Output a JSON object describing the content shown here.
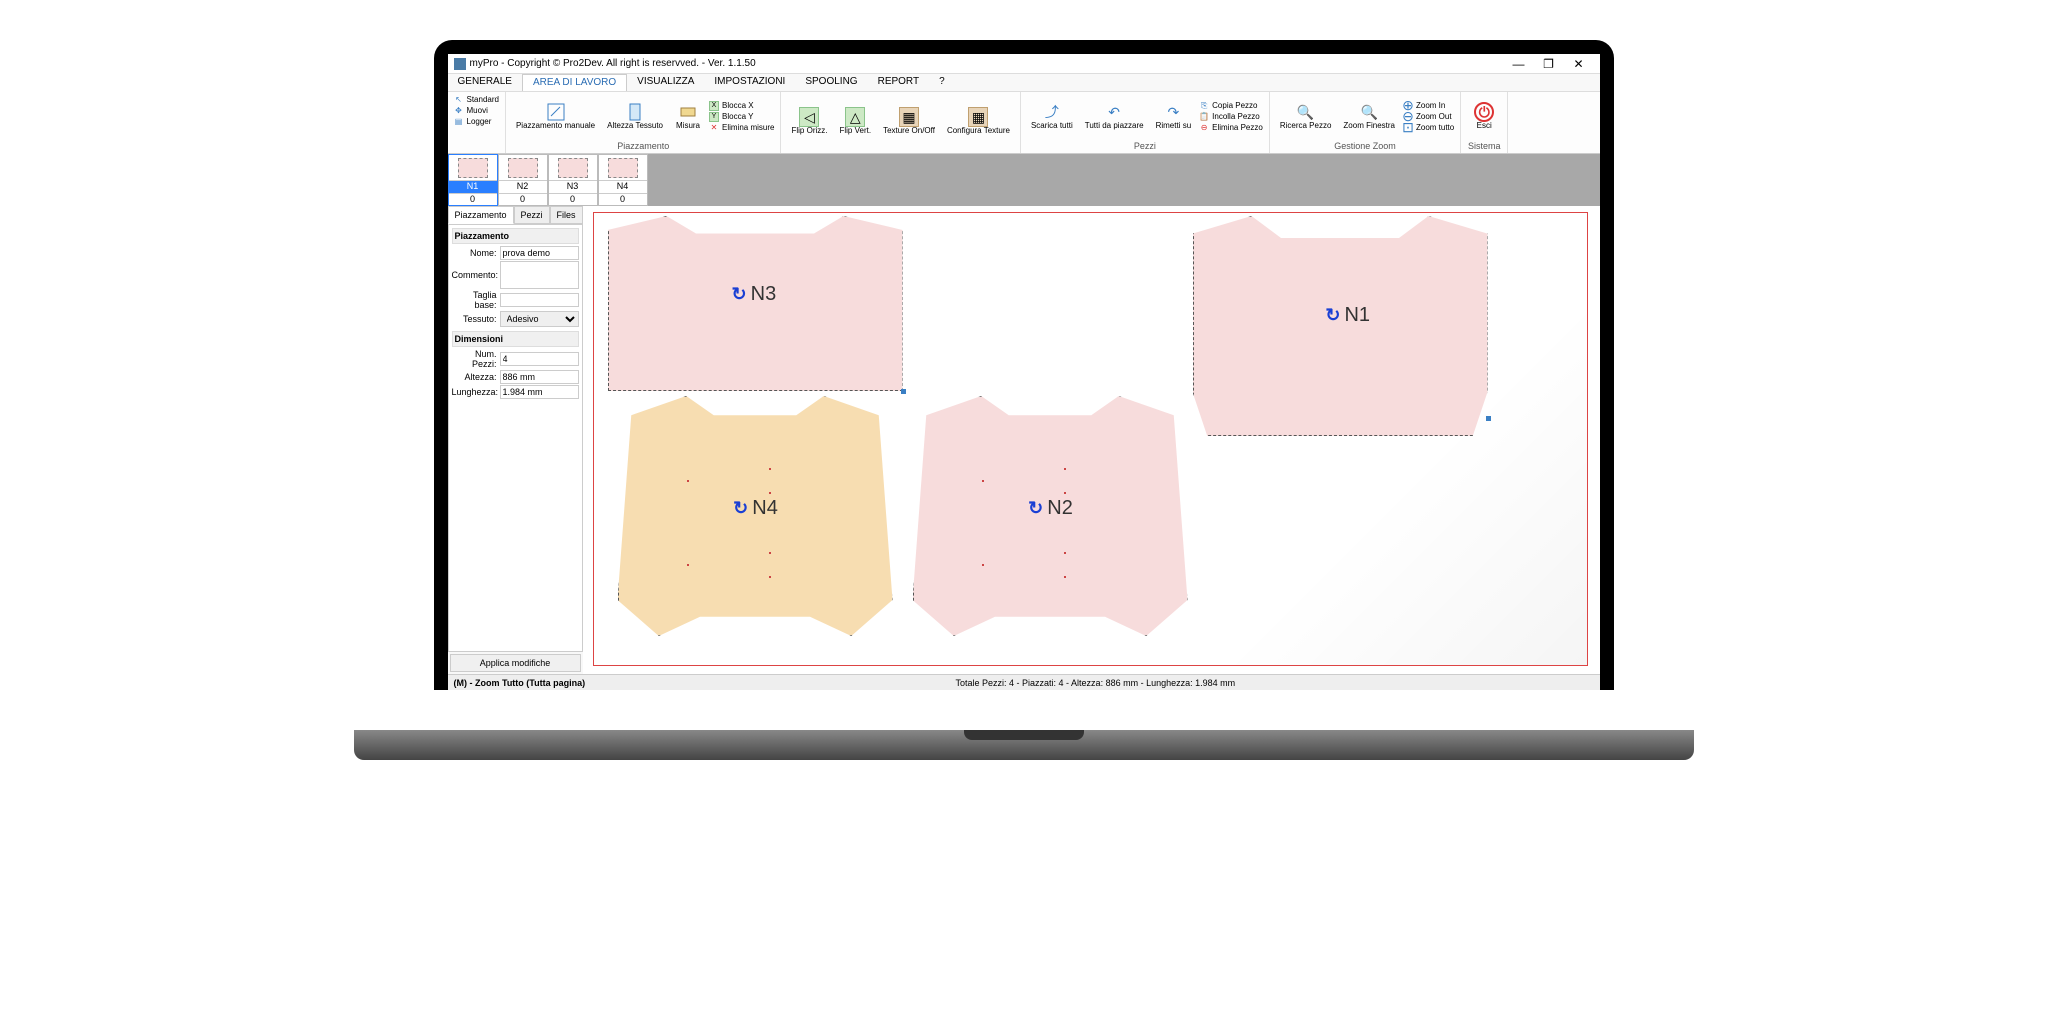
{
  "title": "myPro - Copyright © Pro2Dev. All right is reservved. - Ver. 1.1.50",
  "menu": [
    "GENERALE",
    "AREA DI LAVORO",
    "VISUALIZZA",
    "IMPOSTAZIONI",
    "SPOOLING",
    "REPORT",
    "?"
  ],
  "menu_active": 1,
  "toolbar": {
    "g1": {
      "standard": "Standard",
      "muovi": "Muovi",
      "logger": "Logger"
    },
    "g2": {
      "piazz_man": "Piazzamento\nmanuale",
      "altezza": "Altezza\nTessuto",
      "misura": "Misura",
      "blocca_x": "Blocca X",
      "blocca_y": "Blocca Y",
      "elimina_m": "Elimina misure",
      "group_label": "Piazzamento"
    },
    "g3": {
      "flip_o": "Flip\nOrizz.",
      "flip_v": "Flip\nVert.",
      "tex": "Texture\nOn/Off",
      "conf_tex": "Configura\nTexture"
    },
    "g4": {
      "scarica": "Scarica\ntutti",
      "tutti": "Tutti da\npiazzare",
      "rimetti": "Rimetti\nsu",
      "copia": "Copia Pezzo",
      "incolla": "Incolla Pezzo",
      "elimina": "Elimina Pezzo",
      "group_label": "Pezzi"
    },
    "g5": {
      "ricerca": "Ricerca\nPezzo",
      "zoom_f": "Zoom\nFinestra",
      "zoom_in": "Zoom In",
      "zoom_out": "Zoom Out",
      "zoom_t": "Zoom tutto",
      "group_label": "Gestione Zoom"
    },
    "g6": {
      "esci": "Esci",
      "group_label": "Sistema"
    }
  },
  "thumbs": [
    {
      "label": "N1",
      "count": "0",
      "active": true
    },
    {
      "label": "N2",
      "count": "0",
      "active": false
    },
    {
      "label": "N3",
      "count": "0",
      "active": false
    },
    {
      "label": "N4",
      "count": "0",
      "active": false
    }
  ],
  "side": {
    "tabs": [
      "Piazzamento",
      "Pezzi",
      "Files"
    ],
    "piazz": {
      "title": "Piazzamento",
      "nome_l": "Nome:",
      "nome": "prova demo",
      "comm_l": "Commento:",
      "comm": "",
      "taglia_l": "Taglia base:",
      "taglia": "",
      "tessuto_l": "Tessuto:",
      "tessuto": "Adesivo"
    },
    "dim": {
      "title": "Dimensioni",
      "np_l": "Num. Pezzi:",
      "np": "4",
      "alt_l": "Altezza:",
      "alt": "886 mm",
      "lung_l": "Lunghezza:",
      "lung": "1.984 mm"
    },
    "apply": "Applica modifiche"
  },
  "canvas_pieces": [
    "N1",
    "N2",
    "N3",
    "N4"
  ],
  "status": {
    "left": "(M) - Zoom Tutto (Tutta pagina)",
    "center": "Totale Pezzi: 4 - Piazzati: 4 - Altezza:  886 mm  - Lunghezza:  1.984 mm"
  }
}
